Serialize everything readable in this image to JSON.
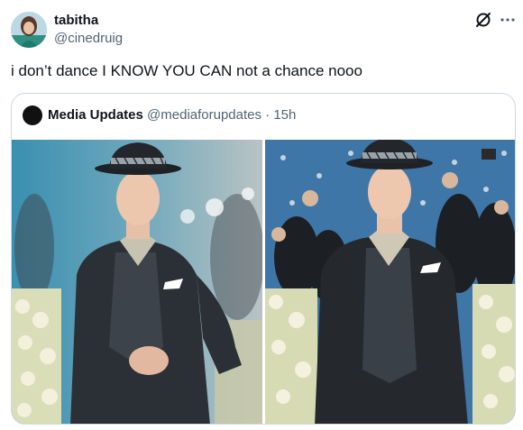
{
  "post": {
    "author_name": "tabitha",
    "author_handle": "@cinedruig",
    "text": "i don’t dance I KNOW YOU CAN not a chance nooo"
  },
  "quote": {
    "author_name": "Media Updates",
    "author_handle": "@mediaforupdates",
    "separator": "·",
    "time": "15h"
  },
  "icons": {
    "grok": "grok-icon",
    "more": "more-icon"
  },
  "colors": {
    "text": "#0f1419",
    "secondary_text": "#536471",
    "border": "#cfd9de"
  }
}
